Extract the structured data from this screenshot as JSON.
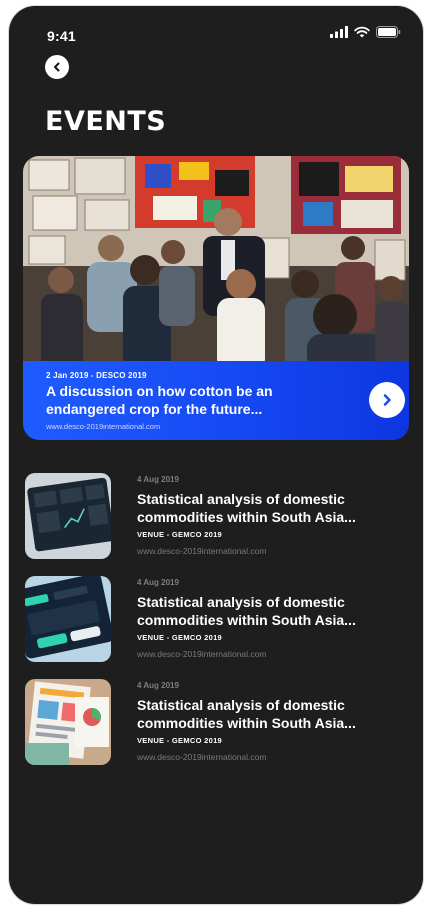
{
  "status_bar": {
    "time": "9:41"
  },
  "header": {
    "title": "EVENTS"
  },
  "featured": {
    "meta": "2 Jan 2019 - DESCO 2019",
    "title": "A discussion on how cotton be an endangered crop for the future...",
    "link": "www.desco-2019international.com",
    "accent": "#1a4ff5"
  },
  "events": [
    {
      "date": "4 Aug 2019",
      "title": "Statistical analysis of domestic commodities within South Asia...",
      "venue": "VENUE - GEMCO 2019",
      "link": "www.desco-2019international.com"
    },
    {
      "date": "4 Aug 2019",
      "title": "Statistical analysis of domestic commodities within South Asia...",
      "venue": "VENUE - GEMCO 2019",
      "link": "www.desco-2019international.com"
    },
    {
      "date": "4 Aug 2019",
      "title": "Statistical analysis of domestic commodities within South Asia...",
      "venue": "VENUE - GEMCO 2019",
      "link": "www.desco-2019international.com"
    }
  ]
}
